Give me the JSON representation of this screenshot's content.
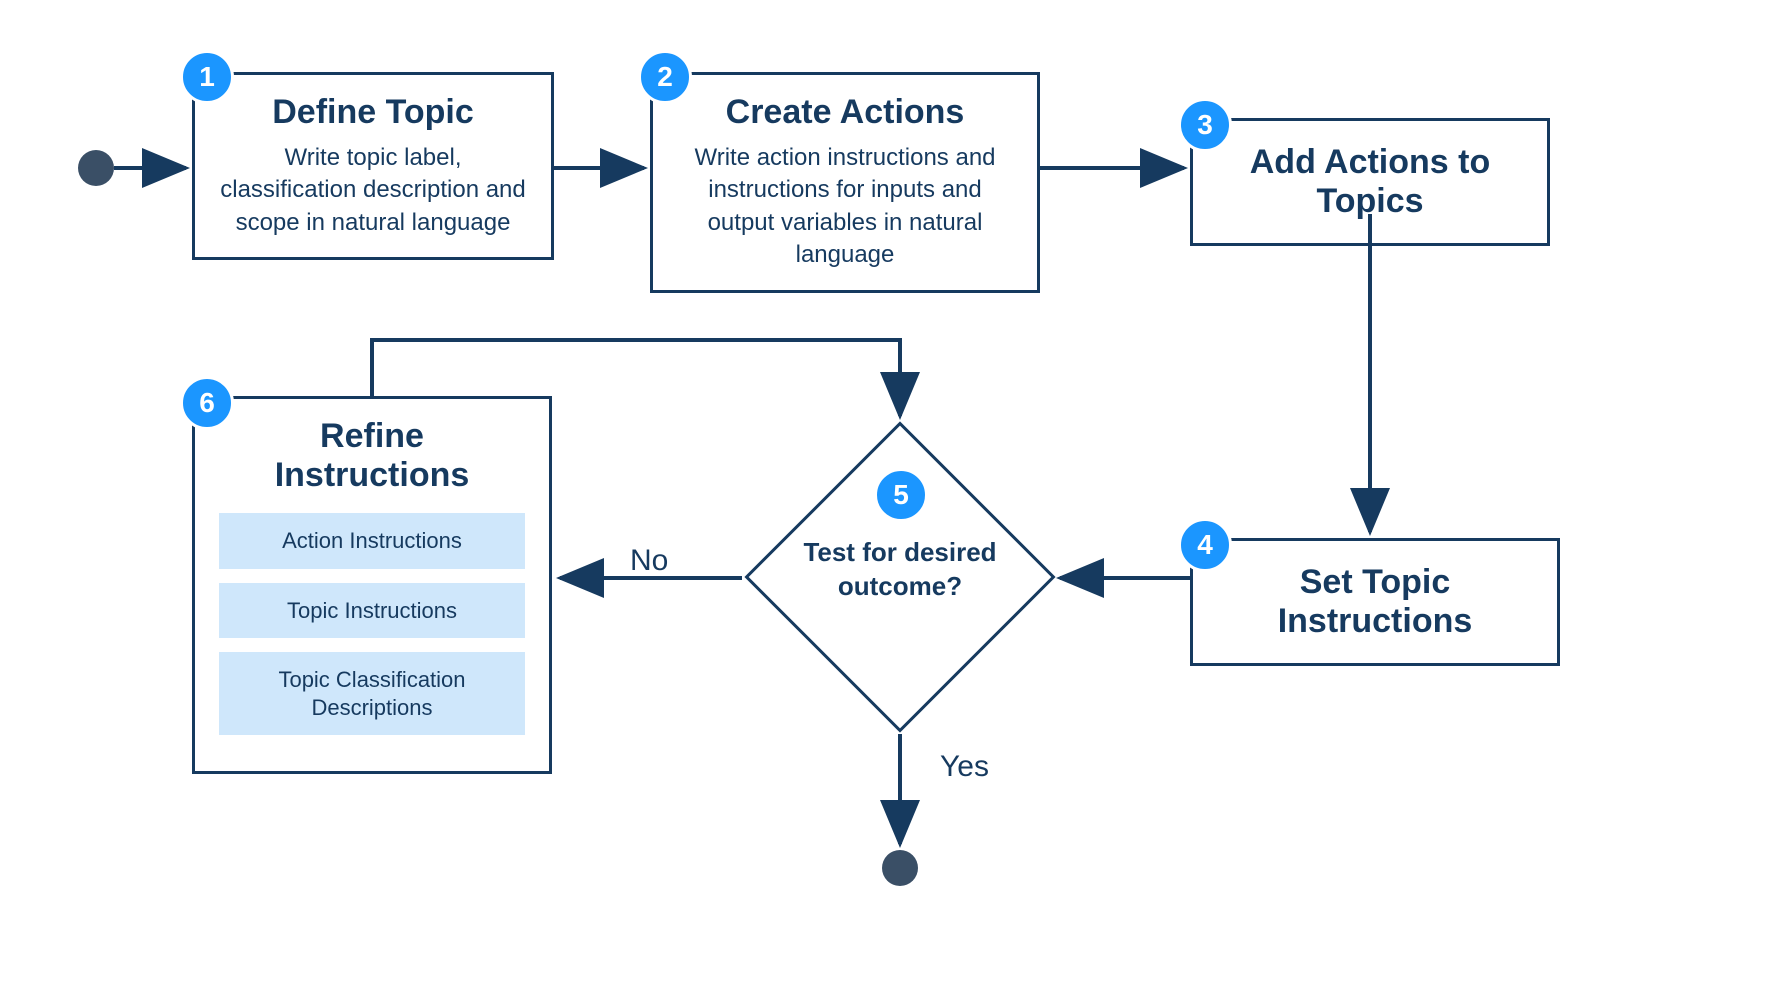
{
  "start": {},
  "end": {},
  "steps": {
    "s1": {
      "num": "1",
      "title": "Define Topic",
      "desc": "Write topic label, classification description and scope in natural language"
    },
    "s2": {
      "num": "2",
      "title": "Create Actions",
      "desc": "Write action instructions and instructions for inputs and output variables in natural language"
    },
    "s3": {
      "num": "3",
      "title": "Add Actions to Topics"
    },
    "s4": {
      "num": "4",
      "title": "Set Topic Instructions"
    },
    "s5": {
      "num": "5",
      "text": "Test for desired outcome?"
    },
    "s6": {
      "num": "6",
      "title": "Refine Instructions",
      "items": [
        "Action Instructions",
        "Topic Instructions",
        "Topic Classification Descriptions"
      ]
    }
  },
  "labels": {
    "no": "No",
    "yes": "Yes"
  }
}
